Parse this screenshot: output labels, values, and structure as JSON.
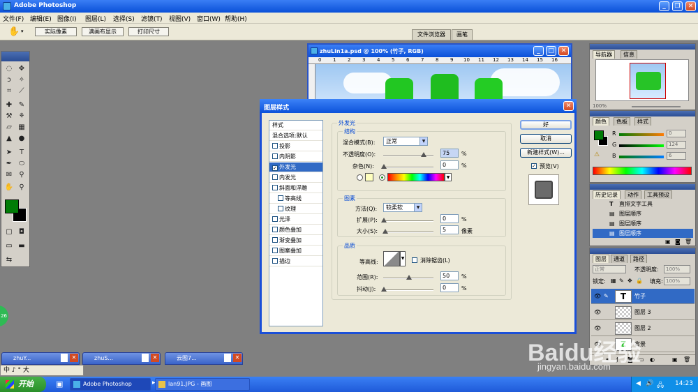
{
  "app": {
    "title": "Adobe Photoshop"
  },
  "menu": [
    "文件(F)",
    "编辑(E)",
    "图像(I)",
    "图层(L)",
    "选择(S)",
    "滤镜(T)",
    "视图(V)",
    "窗口(W)",
    "帮助(H)"
  ],
  "options_bar": {
    "buttons": [
      "实际像素",
      "满画布显示",
      "打印尺寸"
    ],
    "panel_tabs": [
      "文件浏览器",
      "画笔"
    ]
  },
  "document": {
    "title": "zhuLin1a.psd @ 100% (竹子, RGB)",
    "ruler_numbers": [
      "0",
      "1",
      "2",
      "3",
      "4",
      "5",
      "6",
      "7",
      "8",
      "9",
      "10",
      "11",
      "12",
      "13",
      "14",
      "15",
      "16"
    ]
  },
  "dialog": {
    "title": "图层样式",
    "style_list": [
      {
        "label": "样式",
        "type": "head"
      },
      {
        "label": "混合选项:默认",
        "type": "head"
      },
      {
        "label": "投影",
        "checked": false
      },
      {
        "label": "内阴影",
        "checked": false
      },
      {
        "label": "外发光",
        "checked": true,
        "selected": true
      },
      {
        "label": "内发光",
        "checked": false
      },
      {
        "label": "斜面和浮雕",
        "checked": false
      },
      {
        "label": "等高线",
        "checked": false,
        "indent": true
      },
      {
        "label": "纹理",
        "checked": false,
        "indent": true
      },
      {
        "label": "光泽",
        "checked": false
      },
      {
        "label": "颜色叠加",
        "checked": false
      },
      {
        "label": "渐变叠加",
        "checked": false
      },
      {
        "label": "图案叠加",
        "checked": false
      },
      {
        "label": "描边",
        "checked": false
      }
    ],
    "outer_glow": {
      "section_title": "外发光",
      "structure": {
        "title": "结构",
        "blend_mode_label": "混合模式(B):",
        "blend_mode_value": "正常",
        "opacity_label": "不透明度(O):",
        "opacity_value": "75",
        "noise_label": "杂色(N):",
        "noise_value": "0",
        "percent": "%"
      },
      "elements": {
        "title": "图素",
        "technique_label": "方法(Q):",
        "technique_value": "较柔软",
        "spread_label": "扩展(P):",
        "spread_value": "0",
        "size_label": "大小(S):",
        "size_value": "5",
        "px_unit": "像素",
        "percent": "%"
      },
      "quality": {
        "title": "品质",
        "contour_label": "等高线:",
        "antialias_label": "消除锯齿(L)",
        "range_label": "范围(R):",
        "range_value": "50",
        "jitter_label": "抖动(J):",
        "jitter_value": "0",
        "percent": "%"
      }
    },
    "buttons": {
      "ok": "好",
      "cancel": "取消",
      "new_style": "新建样式(W)...",
      "preview": "预览(V)"
    }
  },
  "navigator_panel": {
    "tabs": [
      "导航器",
      "信息"
    ],
    "zoom": "100%"
  },
  "color_panel": {
    "tabs": [
      "颜色",
      "色板",
      "样式"
    ],
    "r_label": "R",
    "r_value": "0",
    "g_label": "G",
    "g_value": "124",
    "b_label": "B",
    "b_value": "6"
  },
  "history_panel": {
    "tabs": [
      "历史记录",
      "动作",
      "工具预设"
    ],
    "items": [
      {
        "label": "直排文字工具",
        "selected": false
      },
      {
        "label": "图层顺序",
        "selected": false
      },
      {
        "label": "图层顺序",
        "selected": false
      },
      {
        "label": "图层顺序",
        "selected": true
      }
    ]
  },
  "layers_panel": {
    "tabs": [
      "图层",
      "通道",
      "路径"
    ],
    "blend_mode": "正常",
    "opacity_label": "不透明度:",
    "opacity_value": "100%",
    "lock_label": "锁定:",
    "fill_label": "填充:",
    "fill_value": "100%",
    "layers": [
      {
        "name": "竹子",
        "type": "text",
        "selected": true
      },
      {
        "name": "图层 3",
        "type": "raster",
        "selected": false
      },
      {
        "name": "图层 2",
        "type": "raster",
        "selected": false
      },
      {
        "name": "背景",
        "type": "raster",
        "selected": false
      }
    ]
  },
  "minimized_docs": [
    "zhuY...",
    "zhuS...",
    "云图7..."
  ],
  "ime_bar": "中 ♪ ° 大",
  "taskbar": {
    "start_label": "开始",
    "items": [
      "Adobe Photoshop",
      "lan91.JPG - 画图"
    ],
    "clock": "14:23"
  },
  "watermark": {
    "main": "Baidu经验",
    "sub": "jingyan.baidu.com"
  },
  "colors": {
    "xp_blue": "#0a50d8",
    "selection": "#316ac5",
    "foreground_swatch": "#007c06",
    "background_swatch": "#000000"
  }
}
